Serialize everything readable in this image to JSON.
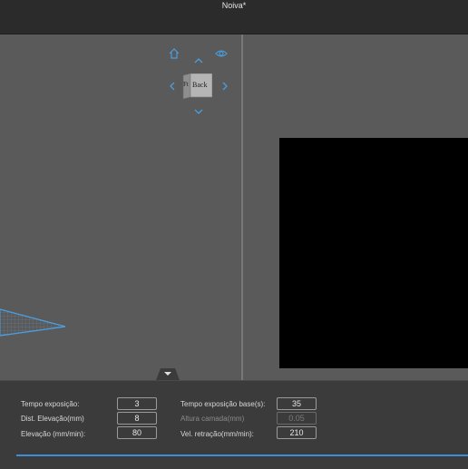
{
  "window": {
    "title": "Noiva*"
  },
  "view_cube": {
    "front_label": "Back",
    "side_label": "Ft",
    "icons": [
      "home-icon",
      "eye-icon",
      "arrow-up-icon",
      "arrow-down-icon",
      "arrow-left-icon",
      "arrow-right-icon"
    ]
  },
  "settings": {
    "exposure_time": {
      "label": "Tempo exposição:",
      "value": "3"
    },
    "lift_distance": {
      "label": "Dist. Elevação(mm)",
      "value": "8"
    },
    "lift_speed": {
      "label": "Elevação (mm/min):",
      "value": "80"
    },
    "base_exposure_time": {
      "label": "Tempo exposição base(s):",
      "value": "35"
    },
    "layer_height": {
      "label": "Altura camada(mm)",
      "value": "0.05",
      "disabled": true
    },
    "retract_speed": {
      "label": "Vel. retração(mm/min):",
      "value": "210"
    }
  },
  "colors": {
    "accent": "#3a8fd6",
    "nav_icon": "#4a9ee0",
    "viewport_bg": "#5a5a5a",
    "slice_bg": "#000000"
  }
}
